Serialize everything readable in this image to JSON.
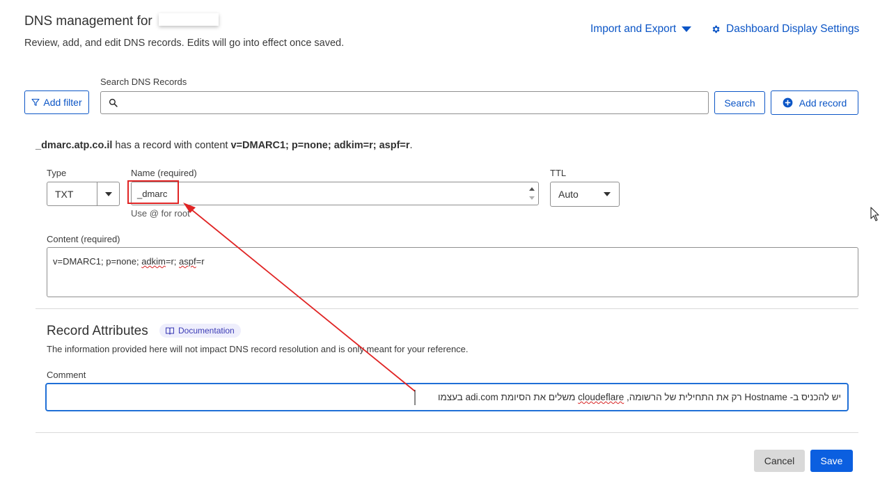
{
  "header": {
    "title": "DNS management for",
    "subtitle": "Review, add, and edit DNS records. Edits will go into effect once saved.",
    "import_export": "Import and Export",
    "dashboard_settings": "Dashboard Display Settings"
  },
  "search": {
    "label": "Search DNS Records",
    "value": "",
    "add_filter": "Add filter",
    "search_button": "Search",
    "add_record": "Add record"
  },
  "notice": {
    "record_name": "_dmarc.atp.co.il",
    "middle": " has a record with content ",
    "content": "v=DMARC1; p=none; adkim=r; aspf=r",
    "end": "."
  },
  "form": {
    "type_label": "Type",
    "type_value": "TXT",
    "name_label": "Name (required)",
    "name_value": "_dmarc",
    "name_hint": "Use @ for root",
    "ttl_label": "TTL",
    "ttl_value": "Auto",
    "content_label": "Content (required)",
    "content_value_part1": "v=DMARC1; p=none; ",
    "content_value_adkim": "adkim",
    "content_value_part2": "=r; ",
    "content_value_aspf": "aspf",
    "content_value_part3": "=r"
  },
  "attributes": {
    "heading": "Record Attributes",
    "doc_badge": "Documentation",
    "info": "The information provided here will not impact DNS record resolution and is only meant for your reference.",
    "comment_label": "Comment",
    "comment_value_a": "יש להכניס ב- Hostname רק את התחילית של הרשומה, ",
    "comment_value_cloudflare": "cloudeflare",
    "comment_value_b": " משלים את הסיומת adi.com בעצמו"
  },
  "actions": {
    "cancel": "Cancel",
    "save": "Save"
  },
  "colors": {
    "accent": "#0b55c6",
    "annotation_red": "#e02424",
    "save_bg": "#0b5fe0"
  }
}
